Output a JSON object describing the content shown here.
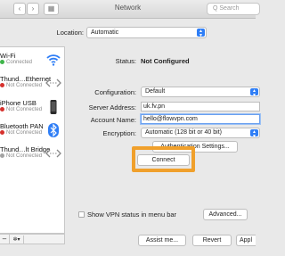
{
  "window": {
    "title": "Network",
    "back": "‹",
    "forward": "›",
    "grid": "▦",
    "search_placeholder": "Q  Search"
  },
  "location": {
    "label": "Location:",
    "value": "Automatic"
  },
  "sidebar": {
    "items": [
      {
        "name": "Wi-Fi",
        "status": "Connected",
        "icon": "wifi-icon"
      },
      {
        "name": "Thund…Ethernet",
        "status": "Not Connected",
        "icon": "ethernet-arrows-icon"
      },
      {
        "name": "iPhone USB",
        "status": "Not Connected",
        "icon": "iphone-icon"
      },
      {
        "name": "Bluetooth PAN",
        "status": "Not Connected",
        "icon": "bluetooth-icon"
      },
      {
        "name": "Thund…lt Bridge",
        "status": "Not Connected",
        "icon": "bridge-arrows-icon"
      }
    ],
    "footer": {
      "minus": "–",
      "gear": "✲▾"
    }
  },
  "detail": {
    "status_label": "Status:",
    "status_value": "Not Configured",
    "configuration_label": "Configuration:",
    "configuration_value": "Default",
    "server_label": "Server Address:",
    "server_value": "uk.fv.pn",
    "account_label": "Account Name:",
    "account_value": "hello@flowvpn.com",
    "encryption_label": "Encryption:",
    "encryption_value": "Automatic (128 bit or 40 bit)",
    "auth_button": "Authentication Settings...",
    "connect_button": "Connect",
    "show_vpn_label": "Show VPN status in menu bar",
    "advanced_button": "Advanced..."
  },
  "footer": {
    "assist_button": "Assist me...",
    "revert_button": "Revert",
    "apply_button": "Appl"
  },
  "colors": {
    "accent": "#2f7ef6",
    "highlight": "#f0a02c"
  }
}
